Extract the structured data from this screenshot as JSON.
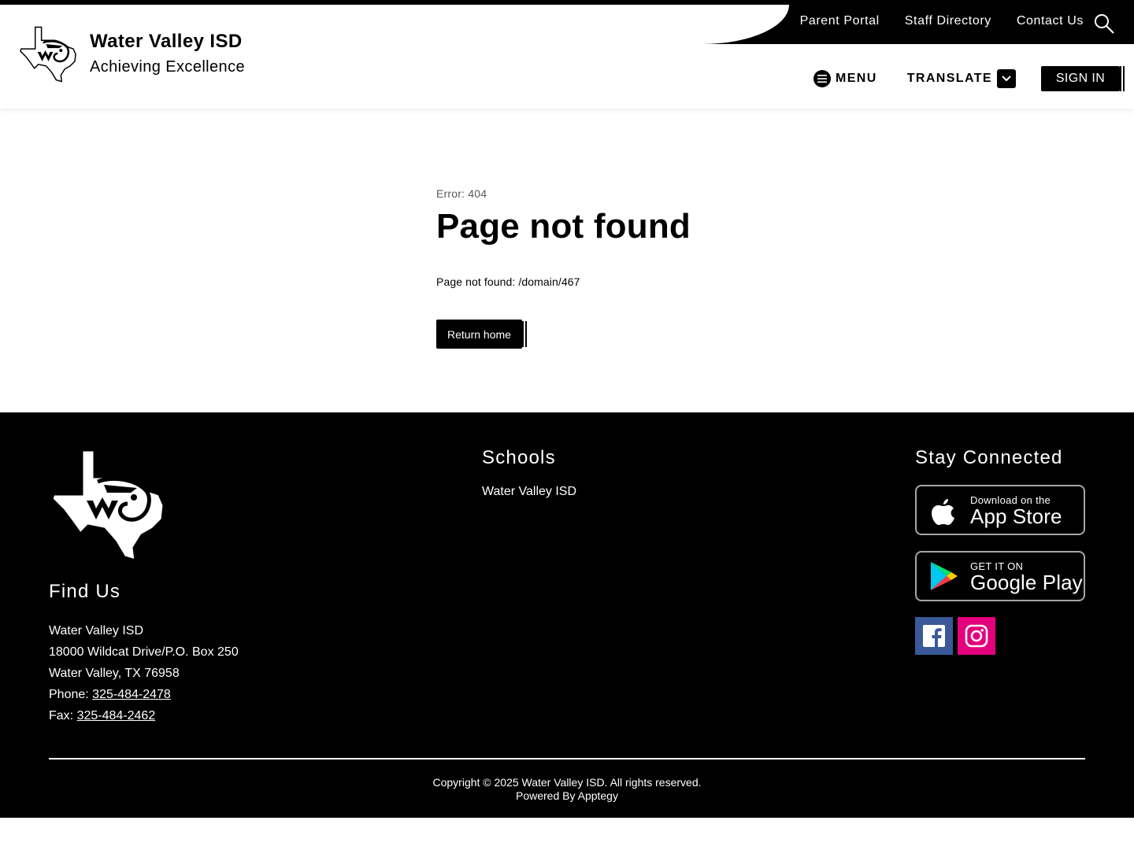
{
  "header": {
    "utility_links": [
      "Parent Portal",
      "Staff Directory",
      "Contact Us"
    ],
    "search_icon": "search-icon",
    "district_name": "Water Valley ISD",
    "tagline": "Achieving Excellence",
    "menu_label": "MENU",
    "translate_label": "TRANSLATE",
    "sign_in_label": "SIGN IN"
  },
  "main": {
    "error_code": "Error: 404",
    "title": "Page not found",
    "message": "Page not found: /domain/467",
    "return_label": "Return home"
  },
  "footer": {
    "find_us_heading": "Find Us",
    "find_us": {
      "name": "Water Valley ISD",
      "street": "18000 Wildcat Drive/P.O. Box 250",
      "city": "Water Valley, TX 76958",
      "phone_label": "Phone:",
      "phone": "325-484-2478",
      "fax_label": "Fax:",
      "fax": "325-484-2462"
    },
    "schools_heading": "Schools",
    "schools": [
      "Water Valley ISD"
    ],
    "stay_connected_heading": "Stay Connected",
    "app_store": {
      "small": "Download on the",
      "big": "App Store"
    },
    "google_play": {
      "small": "GET IT ON",
      "big": "Google Play"
    },
    "social": [
      "facebook-icon",
      "instagram-icon"
    ],
    "copyright": "Copyright © 2025 Water Valley ISD. All rights reserved.",
    "powered_by": "Powered By Apptegy"
  },
  "colors": {
    "primary": "#000000",
    "background": "#ffffff",
    "facebook": "#3b5998",
    "instagram": "#e4007c",
    "muted_text": "#595959"
  }
}
